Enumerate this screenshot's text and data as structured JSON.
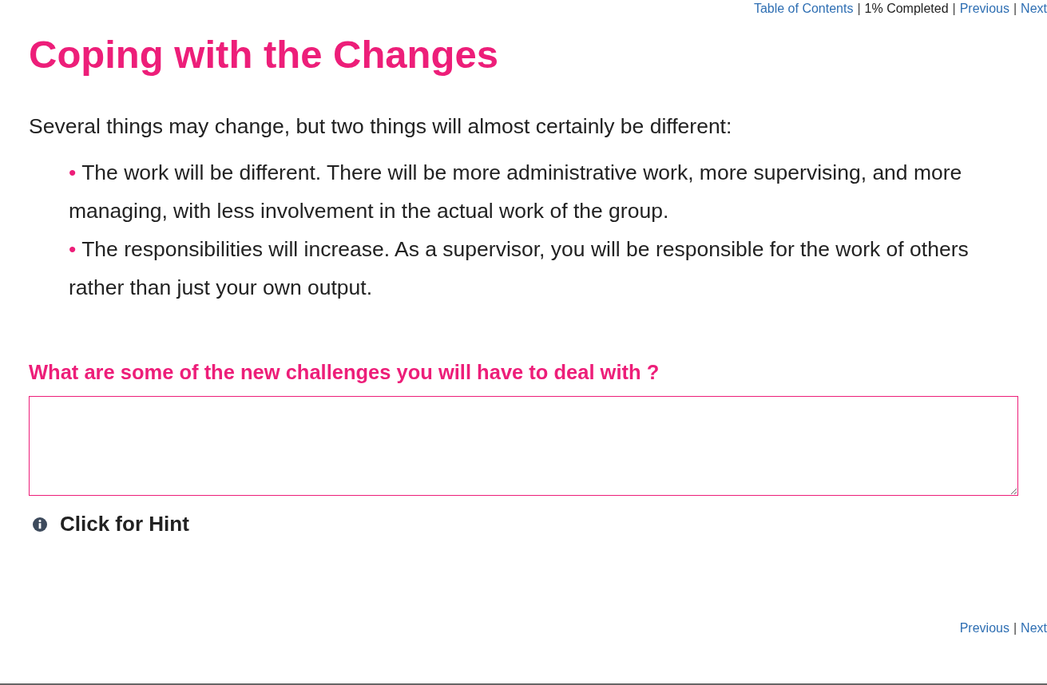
{
  "top_nav": {
    "items": [
      {
        "kind": "link",
        "text": "Table of Contents"
      },
      {
        "kind": "separator",
        "text": "|"
      },
      {
        "kind": "text",
        "text": "1% Completed"
      },
      {
        "kind": "separator",
        "text": "|"
      },
      {
        "kind": "link",
        "text": "Previous"
      },
      {
        "kind": "separator",
        "text": "|"
      },
      {
        "kind": "link",
        "text": "Next"
      }
    ]
  },
  "title": "Coping with the Changes",
  "intro": "Several things may change, but two things will almost certainly be different:",
  "bullets": [
    {
      "marker": "•",
      "text": "The work will be different. There will be more administrative work, more supervising, and more managing, with less involvement in the actual work of the group."
    },
    {
      "marker": "•",
      "text": "The responsibilities will increase. As a supervisor, you will be responsible for the work of others rather than just your own output."
    }
  ],
  "question": {
    "label": "What are some of the new challenges you will have to deal with ?"
  },
  "hint": {
    "text": "Click for Hint"
  },
  "bottom_nav": {
    "items": [
      {
        "kind": "link",
        "text": "Previous"
      },
      {
        "kind": "separator",
        "text": "|"
      },
      {
        "kind": "link",
        "text": "Next"
      }
    ]
  }
}
